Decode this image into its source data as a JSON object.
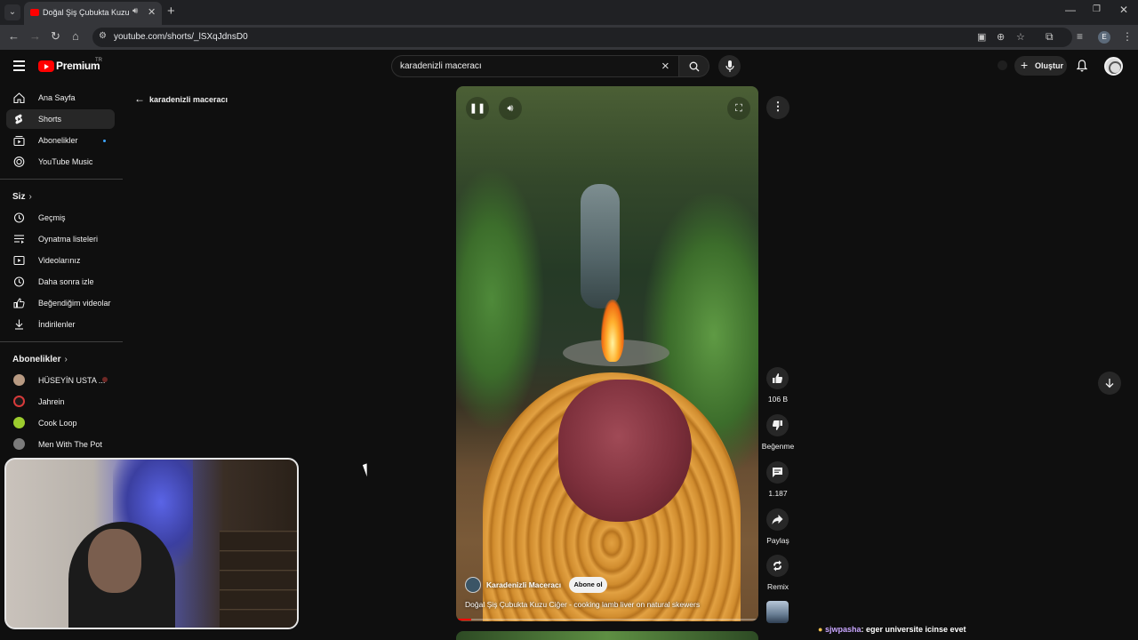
{
  "browser": {
    "tab_title": "Doğal Şiş Çubukta Kuzu Ciğer",
    "url": "youtube.com/shorts/_lSXqJdnsD0"
  },
  "masthead": {
    "logo_text": "Premium",
    "country_code": "TR",
    "search_value": "karadenizli maceracı",
    "create_label": "Oluştur"
  },
  "sidebar": {
    "main": [
      {
        "label": "Ana Sayfa",
        "icon": "home-icon"
      },
      {
        "label": "Shorts",
        "icon": "shorts-icon"
      },
      {
        "label": "Abonelikler",
        "icon": "subscriptions-icon"
      },
      {
        "label": "YouTube Music",
        "icon": "music-icon"
      }
    ],
    "you_header": "Siz",
    "you": [
      {
        "label": "Geçmiş",
        "icon": "history-icon"
      },
      {
        "label": "Oynatma listeleri",
        "icon": "playlists-icon"
      },
      {
        "label": "Videolarınız",
        "icon": "your-videos-icon"
      },
      {
        "label": "Daha sonra izle",
        "icon": "watch-later-icon"
      },
      {
        "label": "Beğendiğim videolar",
        "icon": "liked-icon"
      },
      {
        "label": "İndirilenler",
        "icon": "downloads-icon"
      }
    ],
    "subs_header": "Abonelikler",
    "subscriptions": [
      {
        "label": "HÜSEYİN USTA ...",
        "color": "#b89a82"
      },
      {
        "label": "Jahrein",
        "color": "#d63a3a"
      },
      {
        "label": "Cook Loop",
        "color": "#9ccc2e"
      },
      {
        "label": "Men With The Pot",
        "color": "#7b7b7b"
      }
    ]
  },
  "back_link": "karadenizli maceracı",
  "video": {
    "channel": "Karadenizli Maceracı",
    "subscribe_label": "Abone ol",
    "title": "Doğal Şiş Çubukta Kuzu Ciğer - cooking lamb liver on natural skewers",
    "progress": 0.05
  },
  "actions": {
    "likes": "106 B",
    "dislike_label": "Beğenme",
    "comments": "1.187",
    "share_label": "Paylaş",
    "remix_label": "Remix"
  },
  "chat": {
    "user": "sjwpasha",
    "message": "eger universite icinse evet"
  }
}
